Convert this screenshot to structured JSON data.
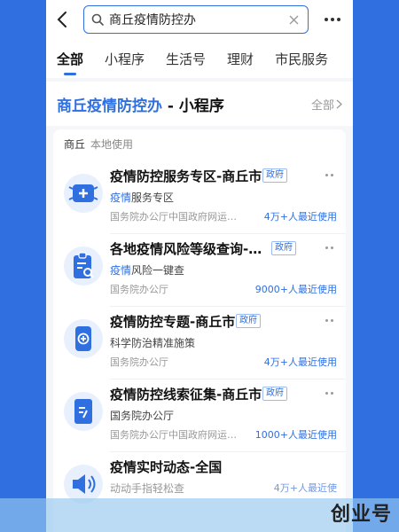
{
  "search": {
    "query": "商丘疫情防控办"
  },
  "tabs": [
    {
      "label": "全部"
    },
    {
      "label": "小程序"
    },
    {
      "label": "生活号"
    },
    {
      "label": "理财"
    },
    {
      "label": "市民服务"
    }
  ],
  "section": {
    "title_highlight": "商丘疫情防控办",
    "title_rest": " - 小程序",
    "all_label": "全部"
  },
  "local": {
    "city": "商丘",
    "tip": "本地使用"
  },
  "items": [
    {
      "name": "疫情防控服务专区-商丘市",
      "badge": "政府",
      "sub_hl": "疫情",
      "sub_rest": "服务专区",
      "source": "国务院办公厅中国政府网运…",
      "users": "4万+人最近使用",
      "icon": "mask-icon"
    },
    {
      "name": "各地疫情风险等级查询-…",
      "badge": "政府",
      "sub_hl": "疫情",
      "sub_rest": "风险一键查",
      "source": "国务院办公厅",
      "users": "9000+人最近使用",
      "icon": "clipboard-search-icon"
    },
    {
      "name": "疫情防控专题-商丘市",
      "badge": "政府",
      "sub_hl": "",
      "sub_rest": "科学防治精准施策",
      "source": "国务院办公厅",
      "users": "4万+人最近使用",
      "icon": "phone-cross-icon"
    },
    {
      "name": "疫情防控线索征集-商丘市",
      "badge": "政府",
      "sub_hl": "",
      "sub_rest": "国务院办公厅",
      "source": "国务院办公厅中国政府网运…",
      "users": "1000+人最近使用",
      "icon": "form-icon"
    },
    {
      "name": "疫情实时动态-全国",
      "badge": "",
      "sub_hl": "",
      "sub_rest": "动动手指轻松查",
      "source": "",
      "users": "4万+人最近使",
      "icon": "speaker-icon"
    }
  ],
  "watermark": "创业号",
  "colors": {
    "accent": "#2f6fe0",
    "background": "#2f6fe0"
  }
}
